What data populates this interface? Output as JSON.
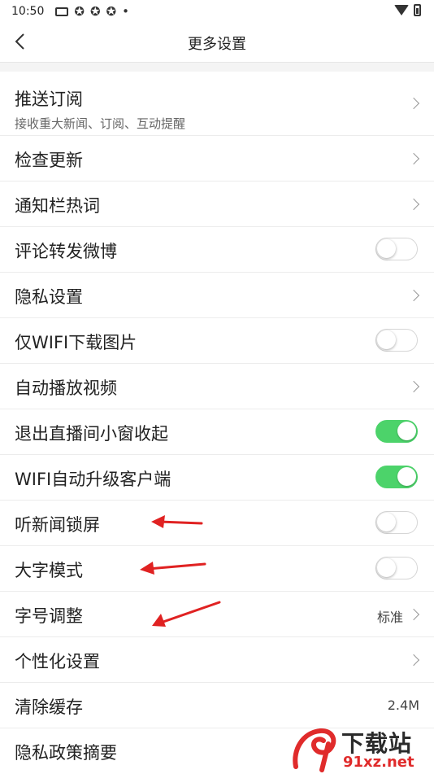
{
  "status_bar": {
    "time": "10:50",
    "dot": "•"
  },
  "header": {
    "title": "更多设置"
  },
  "rows": [
    {
      "label": "推送订阅",
      "sub": "接收重大新闻、订阅、互动提醒",
      "control": "chevron"
    },
    {
      "label": "检查更新",
      "control": "chevron"
    },
    {
      "label": "通知栏热词",
      "control": "chevron"
    },
    {
      "label": "评论转发微博",
      "control": "toggle",
      "on": false
    },
    {
      "label": "隐私设置",
      "control": "chevron"
    },
    {
      "label": "仅WIFI下载图片",
      "control": "toggle",
      "on": false
    },
    {
      "label": "自动播放视频",
      "control": "chevron"
    },
    {
      "label": "退出直播间小窗收起",
      "control": "toggle",
      "on": true
    },
    {
      "label": "WIFI自动升级客户端",
      "control": "toggle",
      "on": true
    },
    {
      "label": "听新闻锁屏",
      "control": "toggle",
      "on": false
    },
    {
      "label": "大字模式",
      "control": "toggle",
      "on": false
    },
    {
      "label": "字号调整",
      "control": "chevron",
      "value": "标准"
    },
    {
      "label": "个性化设置",
      "control": "chevron"
    },
    {
      "label": "清除缓存",
      "control": "value",
      "value": "2.4M"
    },
    {
      "label": "隐私政策摘要",
      "control": "none"
    }
  ],
  "colors": {
    "toggle_on": "#4cd36a",
    "annotation_arrow": "#e02222",
    "watermark_red": "#e02b2b"
  },
  "watermark": {
    "text": "下载站",
    "url": "91xz.net"
  }
}
